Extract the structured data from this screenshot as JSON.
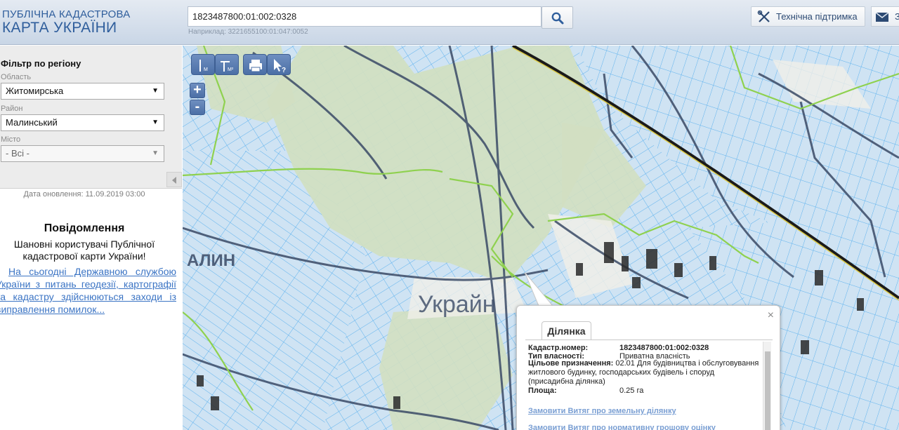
{
  "header": {
    "logo_line1": "ПУБЛІЧНА КАДАСТРОВА",
    "logo_line2": "КАРТА УКРАЇНИ",
    "search_value": "1823487800:01:002:0328",
    "search_hint": "Наприклад: 3221655100:01:047:0052",
    "support_label": "Технічна підтримка",
    "mail_label": "З"
  },
  "filter": {
    "title": "Фільтр по регіону",
    "oblast_label": "Область",
    "oblast_value": "Житомирська",
    "rayon_label": "Район",
    "rayon_value": "Малинський",
    "misto_label": "Місто",
    "misto_value": "- Всі -"
  },
  "sidebar": {
    "updated": "Дата оновлення: 11.09.2019 03:00",
    "notice_title": "Повідомлення",
    "notice_greeting": "Шановні користувачі Публічної кадастрової карти України!",
    "notice_link": "На сьогодні Державною службою України з питань геодезії, картографії та кадастру здійснюються заходи із виправлення помилок..."
  },
  "map": {
    "zoom_in": "+",
    "zoom_out": "-",
    "labels": {
      "malin": "АЛИН",
      "ukraina": "Украйн"
    },
    "colors": {
      "parcel_fill": "#cfe3f3",
      "parcel_line": "#5eb2ee",
      "boundary": "#8fd14f",
      "road": "#3a4a66",
      "forest": "#d1dfc1"
    }
  },
  "popup": {
    "tab": "Ділянка",
    "close": "×",
    "cadastral_label": "Кадастр.номер:",
    "cadastral_value": "1823487800:01:002:0328",
    "ownership_label": "Тип власності:",
    "ownership_value": "Приватна власність",
    "purpose_label": "Цільове призначення:",
    "purpose_value": "02.01 Для будівництва і обслуговування житлового будинку, господарських будівель і споруд (присадибна ділянка)",
    "area_label": "Площа:",
    "area_value": "0.25 га",
    "link1": "Замовити Витяг про земельну ділянку",
    "link2": "Замовити Витяг про нормативну грошову оцінку"
  }
}
